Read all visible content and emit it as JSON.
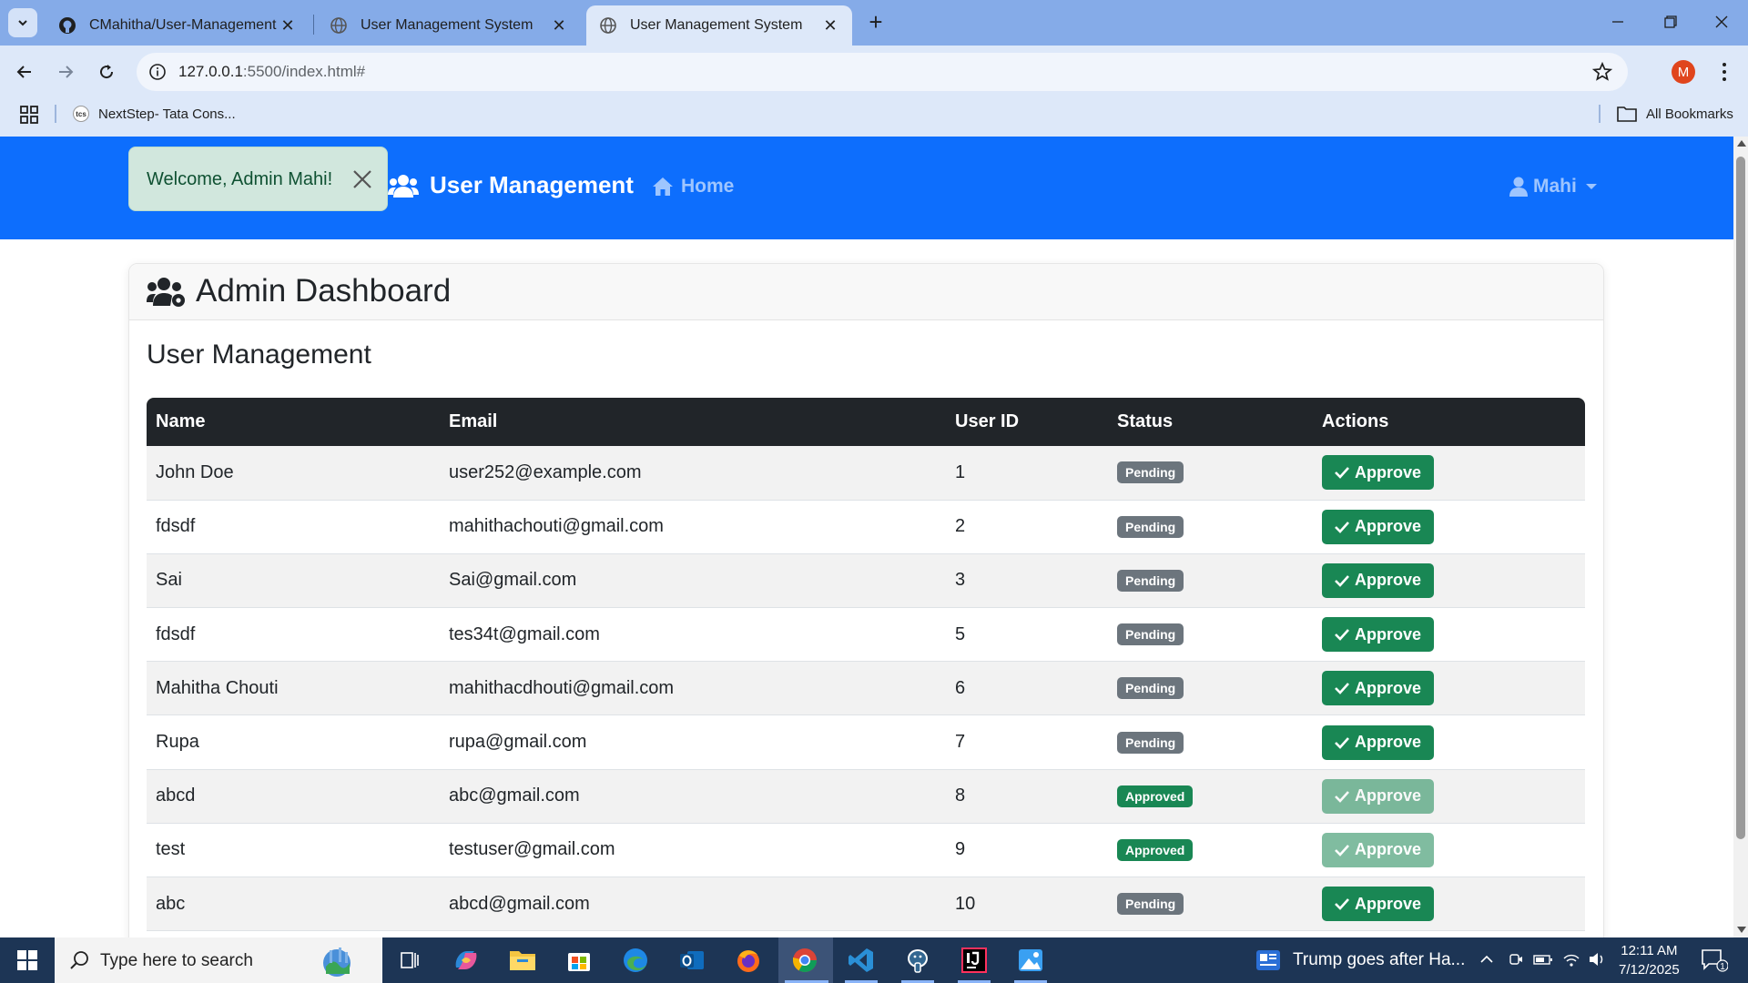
{
  "browser": {
    "tabs": [
      {
        "title": "CMahitha/User-Management",
        "icon": "github-icon",
        "active": false
      },
      {
        "title": "User Management System",
        "icon": "globe-icon",
        "active": false
      },
      {
        "title": "User Management System",
        "icon": "globe-icon",
        "active": true
      }
    ],
    "url_host": "127.0.0.1",
    "url_rest": ":5500/index.html#",
    "profile_initial": "M",
    "bookmarks": [
      {
        "label": "NextStep- Tata Cons..."
      }
    ],
    "bookmark_tcs_text": "tcs",
    "all_bookmarks_label": "All Bookmarks"
  },
  "navbar": {
    "brand": "User Management",
    "home": "Home",
    "user": "Mahi",
    "color": "#0d6efd"
  },
  "toast": {
    "message": "Welcome, Admin Mahi!"
  },
  "dashboard": {
    "title": "Admin Dashboard",
    "section_title": "User Management",
    "columns": [
      "Name",
      "Email",
      "User ID",
      "Status",
      "Actions"
    ],
    "approve_label": "Approve",
    "rows": [
      {
        "name": "John Doe",
        "email": "user252@example.com",
        "id": "1",
        "status": "Pending"
      },
      {
        "name": "fdsdf",
        "email": "mahithachouti@gmail.com",
        "id": "2",
        "status": "Pending"
      },
      {
        "name": "Sai",
        "email": "Sai@gmail.com",
        "id": "3",
        "status": "Pending"
      },
      {
        "name": "fdsdf",
        "email": "tes34t@gmail.com",
        "id": "5",
        "status": "Pending"
      },
      {
        "name": "Mahitha Chouti",
        "email": "mahithacdhouti@gmail.com",
        "id": "6",
        "status": "Pending"
      },
      {
        "name": "Rupa",
        "email": "rupa@gmail.com",
        "id": "7",
        "status": "Pending"
      },
      {
        "name": "abcd",
        "email": "abc@gmail.com",
        "id": "8",
        "status": "Approved"
      },
      {
        "name": "test",
        "email": "testuser@gmail.com",
        "id": "9",
        "status": "Approved"
      },
      {
        "name": "abc",
        "email": "abcd@gmail.com",
        "id": "10",
        "status": "Pending"
      }
    ]
  },
  "taskbar": {
    "search_placeholder": "Type here to search",
    "news": "Trump goes after Ha...",
    "time": "12:11 AM",
    "date": "7/12/2025",
    "notification_count": "1"
  }
}
